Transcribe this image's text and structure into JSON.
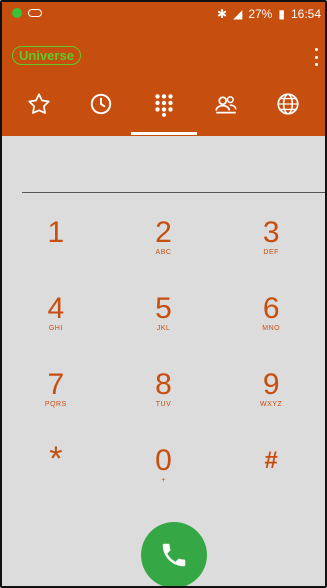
{
  "status_bar": {
    "bluetooth": "✱",
    "wifi": "📶",
    "battery_percent": "27%",
    "time": "16:54"
  },
  "app_bar": {
    "account_label": "Universe"
  },
  "tabs": [
    {
      "name": "favorites",
      "icon": "star-icon"
    },
    {
      "name": "recents",
      "icon": "clock-icon"
    },
    {
      "name": "keypad",
      "icon": "dialpad-icon",
      "active": true
    },
    {
      "name": "contacts",
      "icon": "people-icon"
    },
    {
      "name": "web",
      "icon": "globe-icon"
    }
  ],
  "keypad": [
    {
      "digit": "1",
      "letters": ""
    },
    {
      "digit": "2",
      "letters": "ABC"
    },
    {
      "digit": "3",
      "letters": "DEF"
    },
    {
      "digit": "4",
      "letters": "GHI"
    },
    {
      "digit": "5",
      "letters": "JKL"
    },
    {
      "digit": "6",
      "letters": "MNO"
    },
    {
      "digit": "7",
      "letters": "PQRS"
    },
    {
      "digit": "8",
      "letters": "TUV"
    },
    {
      "digit": "9",
      "letters": "WXYZ"
    },
    {
      "digit": "*",
      "letters": ""
    },
    {
      "digit": "0",
      "letters": "+"
    },
    {
      "digit": "#",
      "letters": ""
    }
  ],
  "colors": {
    "accent": "#c64e0e",
    "call": "#35a845",
    "account_green": "#5ecb2a"
  }
}
